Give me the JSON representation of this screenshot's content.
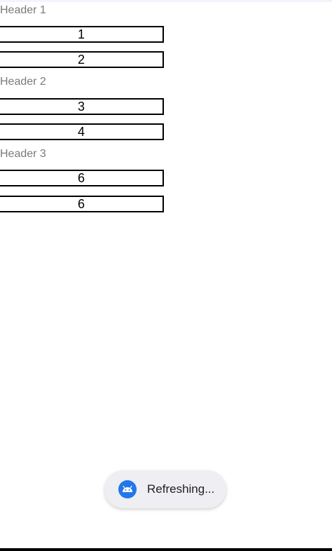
{
  "sections": [
    {
      "header": "Header 1",
      "items": [
        "1",
        "2"
      ]
    },
    {
      "header": "Header 2",
      "items": [
        "3",
        "4"
      ]
    },
    {
      "header": "Header 3",
      "items": [
        "6",
        "6"
      ]
    }
  ],
  "toast": {
    "icon": "android-app-icon",
    "text": "Refreshing..."
  },
  "colors": {
    "header_text": "#7a7a7a",
    "item_border": "#000000",
    "toast_bg": "#eeeef3",
    "icon_bg": "#1a73e8"
  }
}
